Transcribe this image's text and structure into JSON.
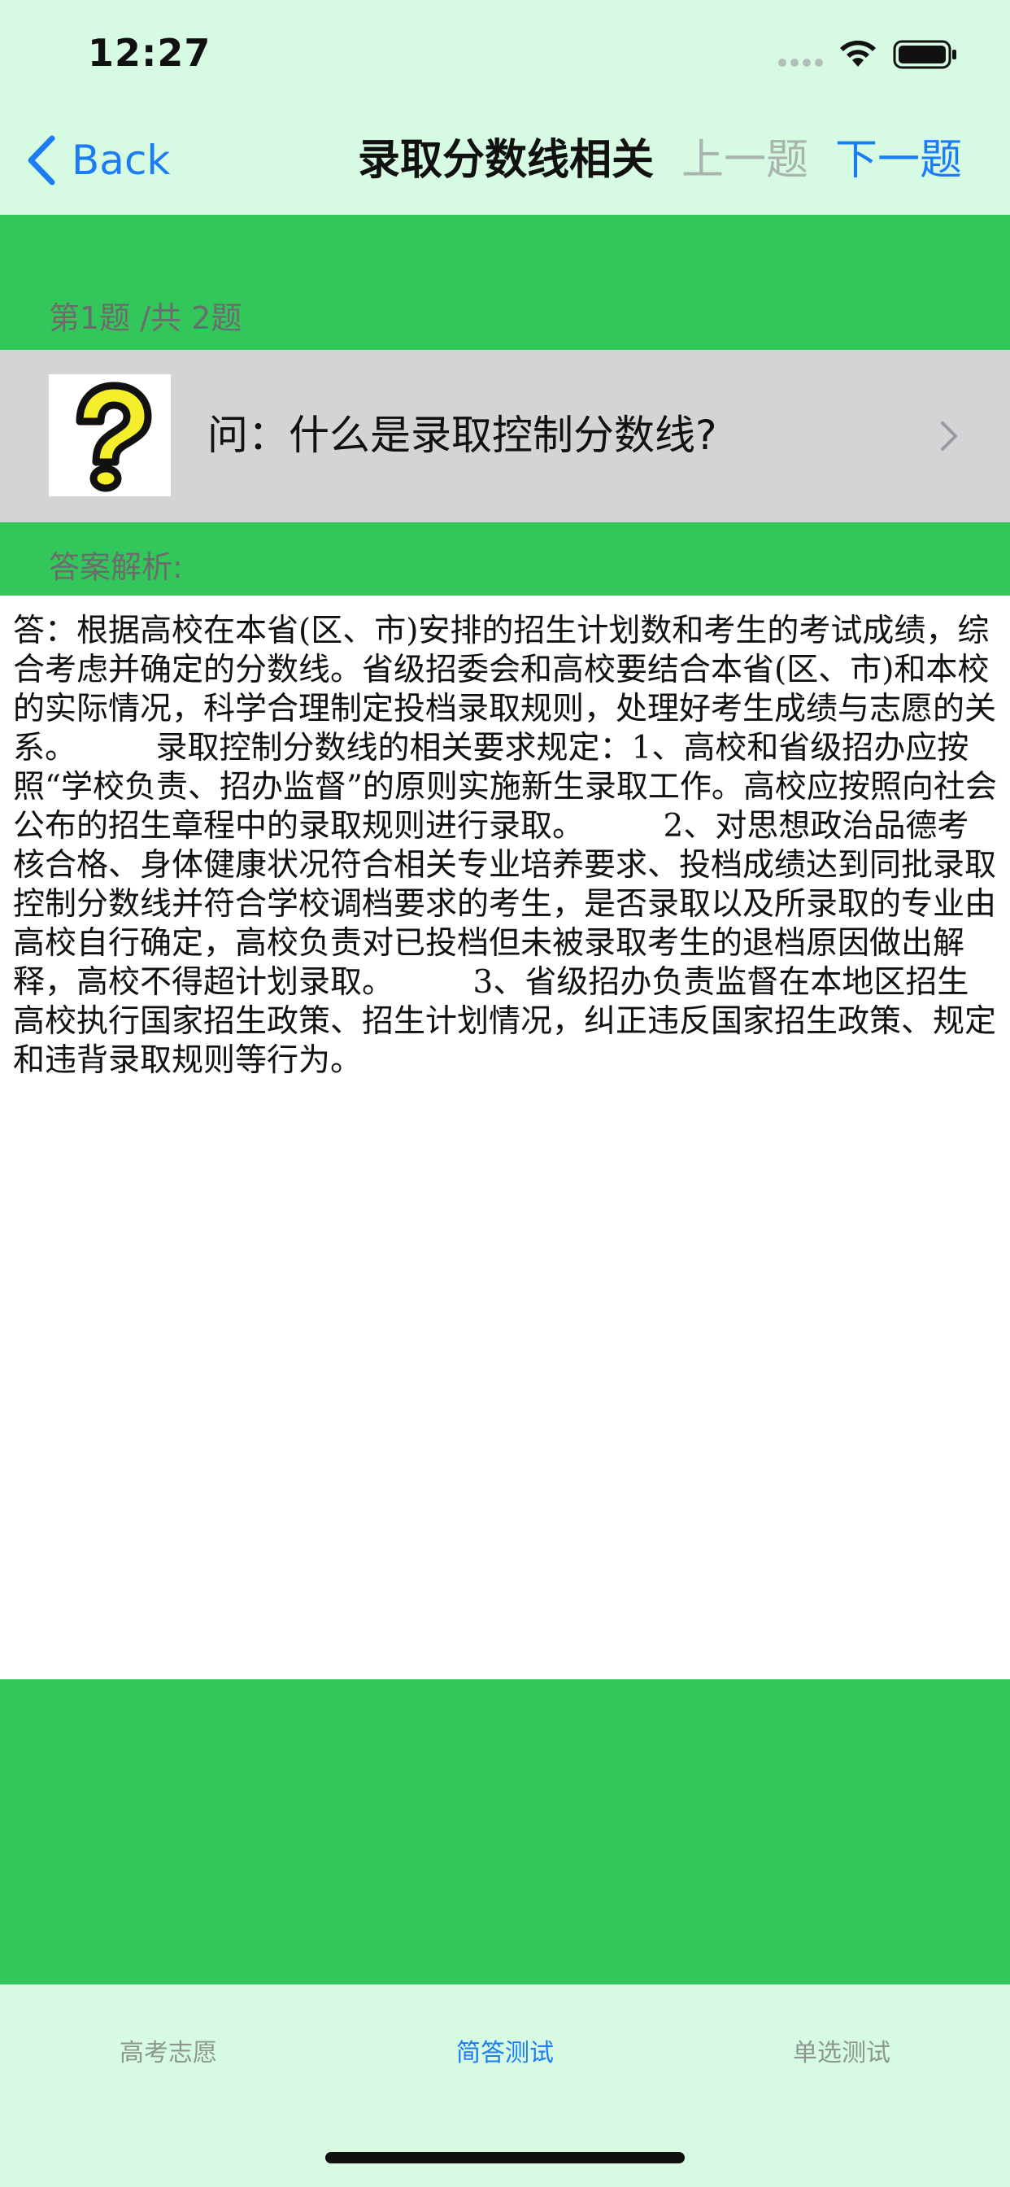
{
  "status_bar": {
    "time": "12:27"
  },
  "nav": {
    "back_label": "Back",
    "title": "录取分数线相关",
    "prev_label": "上一题",
    "next_label": "下一题"
  },
  "question": {
    "counter": "第1题 /共 2题",
    "text": "问：什么是录取控制分数线?",
    "icon": "question-mark-icon"
  },
  "answer": {
    "section_label": "答案解析:",
    "body": "答：根据高校在本省(区、市)安排的招生计划数和考生的考试成绩，综合考虑并确定的分数线。省级招委会和高校要结合本省(区、市)和本校的实际情况，科学合理制定投档录取规则，处理好考生成绩与志愿的关系。　　　录取控制分数线的相关要求规定：1、高校和省级招办应按照“学校负责、招办监督”的原则实施新生录取工作。高校应按照向社会公布的招生章程中的录取规则进行录取。　　　2、对思想政治品德考核合格、身体健康状况符合相关专业培养要求、投档成绩达到同批录取控制分数线并符合学校调档要求的考生，是否录取以及所录取的专业由高校自行确定，高校负责对已投档但未被录取考生的退档原因做出解释，高校不得超计划录取。　　　3、省级招办负责监督在本地区招生高校执行国家招生政策、招生计划情况，纠正违反国家招生政策、规定和违背录取规则等行为。"
  },
  "tabs": [
    {
      "label": "高考志愿",
      "active": false
    },
    {
      "label": "简答测试",
      "active": true
    },
    {
      "label": "单选测试",
      "active": false
    }
  ],
  "colors": {
    "background": "#d6fbe2",
    "green": "#33c65a",
    "accent": "#1c7cf4",
    "question_row": "#d4d4d6",
    "disabled": "#a9b4ae"
  }
}
